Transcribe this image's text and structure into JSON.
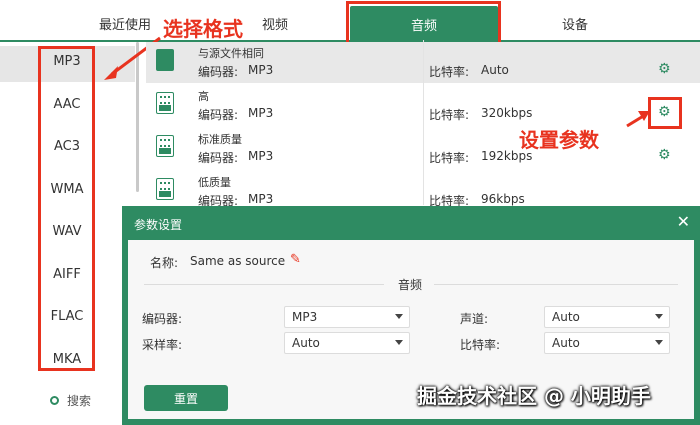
{
  "tabs": [
    "最近使用",
    "视频",
    "音频",
    "设备"
  ],
  "annotations": {
    "select_format": "选择格式",
    "set_params": "设置参数"
  },
  "formats": [
    "MP3",
    "AAC",
    "AC3",
    "WMA",
    "WAV",
    "AIFF",
    "FLAC",
    "MKA"
  ],
  "search_label": "搜索",
  "presets": [
    {
      "name": "与源文件相同",
      "codec_label": "编码器:",
      "codec": "MP3",
      "bitrate_label": "比特率:",
      "bitrate": "Auto"
    },
    {
      "name": "高",
      "codec_label": "编码器:",
      "codec": "MP3",
      "bitrate_label": "比特率:",
      "bitrate": "320kbps"
    },
    {
      "name": "标准质量",
      "codec_label": "编码器:",
      "codec": "MP3",
      "bitrate_label": "比特率:",
      "bitrate": "192kbps"
    },
    {
      "name": "低质量",
      "codec_label": "编码器:",
      "codec": "MP3",
      "bitrate_label": "比特率:",
      "bitrate": "96kbps"
    }
  ],
  "dialog": {
    "title": "参数设置",
    "close": "✕",
    "name_label": "名称:",
    "name_value": "Same as source",
    "section_label": "音频",
    "encoder_label": "编码器:",
    "encoder_value": "MP3",
    "channel_label": "声道:",
    "channel_value": "Auto",
    "samplerate_label": "采样率:",
    "samplerate_value": "Auto",
    "bitrate_label": "比特率:",
    "bitrate_value": "Auto",
    "reset_label": "重置"
  },
  "watermark": "掘金技术社区 @ 小明助手",
  "colors": {
    "accent": "#2e8b62",
    "annotation": "#e8331f"
  }
}
